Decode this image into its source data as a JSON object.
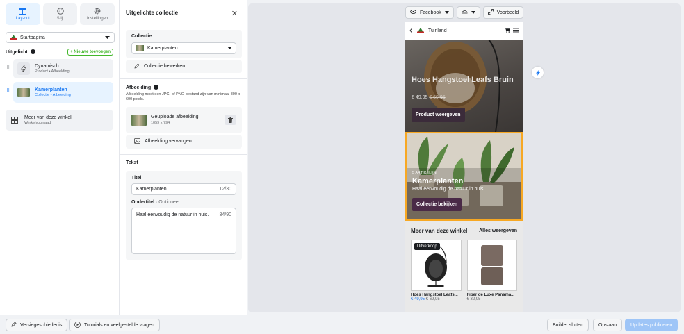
{
  "tabs": [
    {
      "label": "Lay-out",
      "icon": "layout-icon",
      "active": true
    },
    {
      "label": "Stijl",
      "icon": "palette-icon",
      "active": false
    },
    {
      "label": "Instellingen",
      "icon": "gear-icon",
      "active": false
    }
  ],
  "page_select": {
    "value": "Startpagina"
  },
  "featured": {
    "title": "Uitgelicht",
    "new_button": "+ Nieuwe toevoegen",
    "items": [
      {
        "title": "Dynamisch",
        "subtitle": "Product • Afbeelding"
      },
      {
        "title": "Kamerplanten",
        "subtitle": "Collectie • Afbeelding"
      },
      {
        "title": "Meer van deze winkel",
        "subtitle": "Winkelvoorraad"
      }
    ]
  },
  "panel": {
    "title": "Uitgelichte collectie",
    "collection": {
      "label": "Collectie",
      "value": "Kamerplanten",
      "edit": "Collectie bewerken"
    },
    "image": {
      "label": "Afbeelding",
      "desc": "Afbeelding moet een JPG- of PNG-bestand zijn van minimaal 800 x 600 pixels.",
      "file_name": "Geüploade afbeelding",
      "file_size": "1059 x 794",
      "replace": "Afbeelding vervangen"
    },
    "text": {
      "label": "Tekst",
      "title_label": "Titel",
      "title_value": "Kamerplanten",
      "title_count": "12/30",
      "subtitle_label": "Ondertitel",
      "subtitle_optional": "· Optioneel",
      "subtitle_value": "Haal eenvoudig de natuur in huis.",
      "subtitle_count": "34/90"
    }
  },
  "preview": {
    "platform": "Facebook",
    "preview_btn": "Voorbeeld",
    "store_name": "Tuinland",
    "hero1": {
      "title": "Hoes Hangstoel Leafs Bruin",
      "price": "€ 49,95",
      "old_price": "€ 69,95",
      "button": "Product weergeven"
    },
    "hero2": {
      "kicker": "5 ARTIKELEN",
      "title": "Kamerplanten",
      "subtitle": "Haal eenvoudig de natuur in huis.",
      "button": "Collectie bekijken"
    },
    "more": {
      "title": "Meer van deze winkel",
      "see_all": "Alles weergeven",
      "products": [
        {
          "badge": "Uitverkoop",
          "name": "Hoes Hangstoel Leafs...",
          "price": "€ 49,95",
          "old_price": "€ 69,95"
        },
        {
          "badge": "",
          "name": "Fiber de Luxe Panama...",
          "price": "€ 32,95",
          "old_price": ""
        }
      ]
    }
  },
  "bottom": {
    "history": "Versiegeschiedenis",
    "tutorials": "Tutorials en veelgestelde vragen",
    "close": "Builder sluiten",
    "save": "Opslaan",
    "publish": "Updates publiceren"
  },
  "colors": {
    "accent": "#1877f2",
    "highlight": "#f7a823",
    "new_green": "#42b72a"
  }
}
